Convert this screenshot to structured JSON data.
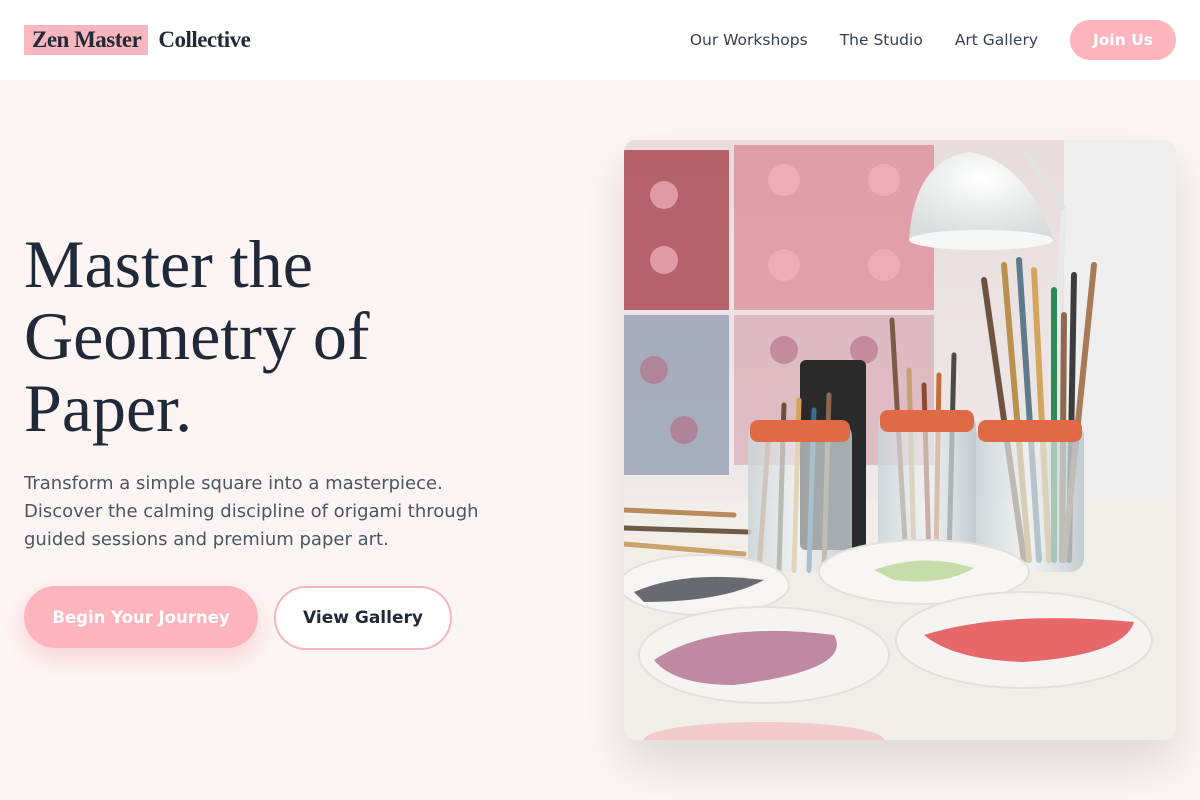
{
  "header": {
    "logo_highlight": "Zen Master",
    "logo_rest": "Collective",
    "nav": [
      {
        "label": "Our Workshops"
      },
      {
        "label": "The Studio"
      },
      {
        "label": "Art Gallery"
      }
    ],
    "join_label": "Join Us"
  },
  "hero": {
    "title_lines": [
      "Master the",
      "Geometry of",
      "Paper."
    ],
    "subtitle_lines": [
      "Transform a simple square into a masterpiece.",
      "Discover the calming discipline of origami through",
      "guided sessions and premium paper art."
    ],
    "primary_cta": "Begin Your Journey",
    "secondary_cta": "View Gallery",
    "image_subject": "art studio table with paint brushes in jars and paint palettes"
  },
  "colors": {
    "accent_pink": "#fdb4bc",
    "page_bg": "#fdf4f4",
    "text_dark": "#1f2937",
    "text_muted": "#4b5563"
  }
}
